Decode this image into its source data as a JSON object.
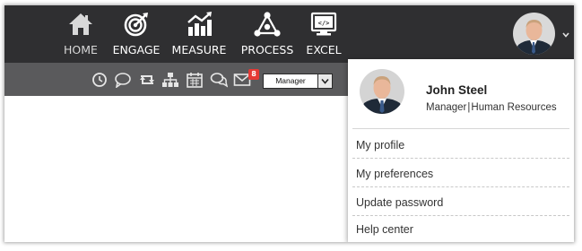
{
  "nav": {
    "items": [
      {
        "label": "HOME",
        "icon": "home-icon"
      },
      {
        "label": "ENGAGE",
        "icon": "target-icon"
      },
      {
        "label": "MEASURE",
        "icon": "chart-icon"
      },
      {
        "label": "PROCESS",
        "icon": "process-icon"
      },
      {
        "label": "EXCEL",
        "icon": "excel-icon"
      }
    ]
  },
  "toolbar": {
    "icons": [
      "clock-icon",
      "comment-icon",
      "retweet-icon",
      "sitemap-icon",
      "calendar-icon",
      "chat-icon",
      "mail-icon"
    ],
    "mail_badge": "8",
    "role_select": {
      "value": "Manager"
    }
  },
  "profile": {
    "name": "John Steel",
    "role": "Manager",
    "department": "Human Resources"
  },
  "menu": {
    "items": [
      {
        "label": "My profile"
      },
      {
        "label": "My preferences"
      },
      {
        "label": "Update password"
      },
      {
        "label": "Help center"
      }
    ]
  },
  "colors": {
    "topbar": "#2f2f31",
    "subbar": "#5a5a5c",
    "badge": "#e53935"
  }
}
